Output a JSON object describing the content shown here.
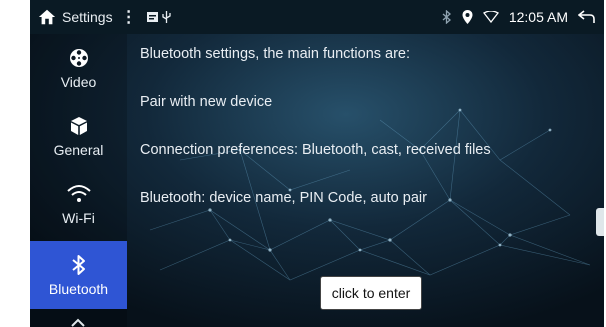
{
  "status_bar": {
    "title": "Settings",
    "menu_glyph": "⋮",
    "notifications": [
      "image-icon",
      "usb-icon"
    ],
    "indicators": [
      "bluetooth-icon",
      "location-icon",
      "wifi-icon"
    ],
    "time": "12:05 AM",
    "back_icon": "back-arrow-icon"
  },
  "sidebar": {
    "items": [
      {
        "label": "Video",
        "icon": "film-reel-icon"
      },
      {
        "label": "General",
        "icon": "cube-icon"
      },
      {
        "label": "Wi-Fi",
        "icon": "wifi-icon"
      },
      {
        "label": "Bluetooth",
        "icon": "bluetooth-icon",
        "active": true
      }
    ]
  },
  "main": {
    "heading": "Bluetooth settings, the main functions are:",
    "lines": [
      "Pair with new device",
      "Connection preferences: Bluetooth, cast, received files",
      "Bluetooth: device name, PIN Code, auto pair"
    ],
    "enter_label": "click to enter"
  },
  "colors": {
    "accent": "#2f55d4",
    "background": "#0b1620",
    "text": "#e9eef3"
  }
}
